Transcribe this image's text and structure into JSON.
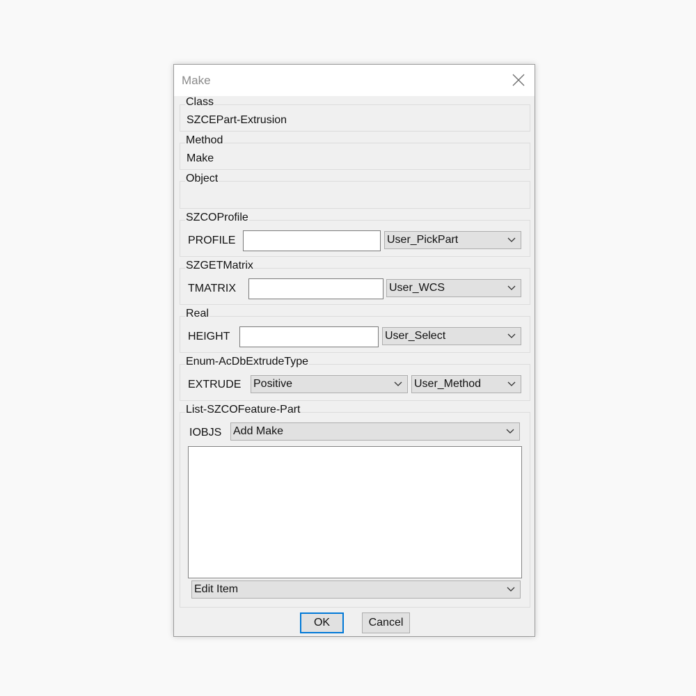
{
  "dialog": {
    "title": "Make",
    "close_icon": "close-icon"
  },
  "class_group": {
    "legend": "Class",
    "value": "SZCEPart-Extrusion"
  },
  "method_group": {
    "legend": "Method",
    "value": "Make"
  },
  "object_group": {
    "legend": "Object",
    "value": ""
  },
  "profile_group": {
    "legend": "SZCOProfile",
    "label": "PROFILE",
    "input_value": "",
    "source_combo": "User_PickPart"
  },
  "matrix_group": {
    "legend": "SZGETMatrix",
    "label": "TMATRIX",
    "input_value": "",
    "source_combo": "User_WCS"
  },
  "real_group": {
    "legend": "Real",
    "label": "HEIGHT",
    "input_value": "",
    "source_combo": "User_Select"
  },
  "enum_group": {
    "legend": "Enum-AcDbExtrudeType",
    "label": "EXTRUDE",
    "value_combo": "Positive",
    "source_combo": "User_Method"
  },
  "list_group": {
    "legend": "List-SZCOFeature-Part",
    "label": "IOBJS",
    "action_combo": "Add Make",
    "items": [],
    "edit_combo": "Edit Item"
  },
  "buttons": {
    "ok": "OK",
    "cancel": "Cancel"
  },
  "colors": {
    "default_button_border": "#0078d7",
    "dialog_background": "#f0f0f0",
    "title_text": "#8a8a8a"
  }
}
